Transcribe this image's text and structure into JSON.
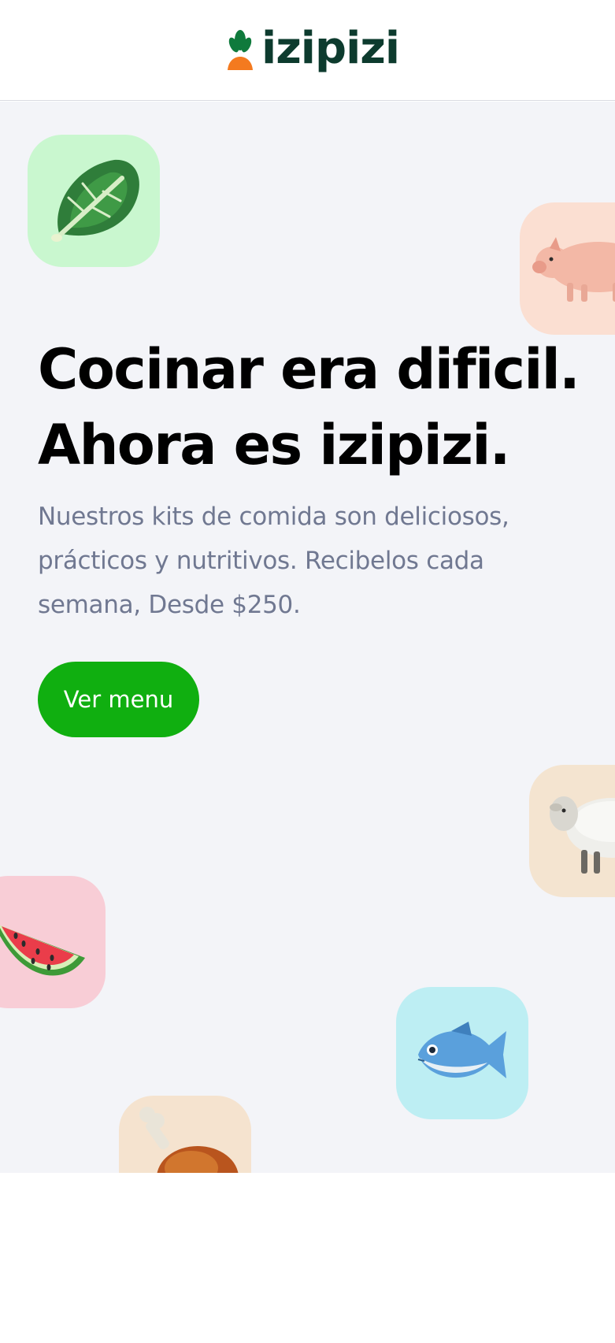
{
  "header": {
    "logo_text": "izipizi",
    "logo_icon": "carrot-icon"
  },
  "hero": {
    "headline_line1": "Cocinar era dificil.",
    "headline_line2": "Ahora es izipizi.",
    "subtitle": "Nuestros kits de comida son deliciosos, prácticos y nutritivos. Recibelos cada semana, Desde $250.",
    "cta_label": "Ver menu"
  },
  "tiles": [
    {
      "icon": "lettuce-icon",
      "color": "#c9f7cf"
    },
    {
      "icon": "pig-icon",
      "color": "#fbdfd2"
    },
    {
      "icon": "sheep-icon",
      "color": "#f4e4d0"
    },
    {
      "icon": "watermelon-icon",
      "color": "#f8cdd6"
    },
    {
      "icon": "fish-icon",
      "color": "#bdeef3"
    },
    {
      "icon": "chicken-leg-icon",
      "color": "#f5e3cf"
    }
  ],
  "colors": {
    "brand_dark": "#0d3b2e",
    "cta_green": "#10af10",
    "carrot_orange": "#f47a1f",
    "hero_bg": "#f3f4f8",
    "subtitle_gray": "#707891"
  }
}
